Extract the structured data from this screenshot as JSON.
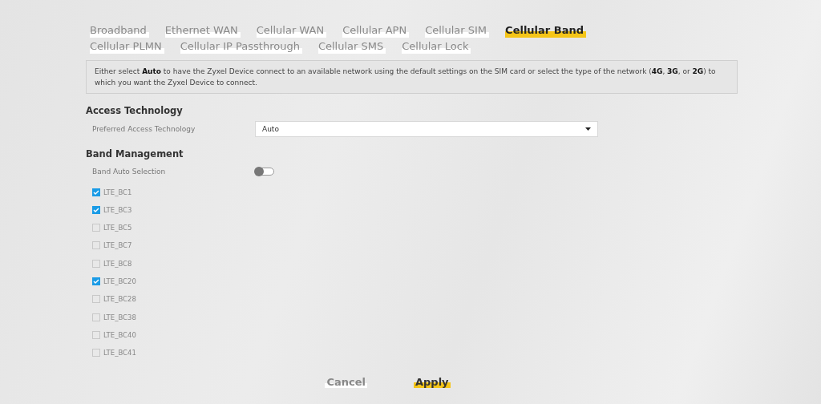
{
  "tabs": [
    {
      "label": "Broadband",
      "selected": false
    },
    {
      "label": "Ethernet WAN",
      "selected": false
    },
    {
      "label": "Cellular WAN",
      "selected": false
    },
    {
      "label": "Cellular APN",
      "selected": false
    },
    {
      "label": "Cellular SIM",
      "selected": false
    },
    {
      "label": "Cellular Band",
      "selected": true
    },
    {
      "label": "Cellular PLMN",
      "selected": false
    },
    {
      "label": "Cellular IP Passthrough",
      "selected": false
    },
    {
      "label": "Cellular SMS",
      "selected": false
    },
    {
      "label": "Cellular Lock",
      "selected": false
    }
  ],
  "info": "Either select **Auto** to have the Zyxel Device connect to an available network using the default settings on the SIM card or select the type of the network (**4G**, **3G**, or **2G**) to which you want the Zyxel Device to connect.",
  "access_technology": {
    "heading": "Access Technology",
    "label": "Preferred Access Technology",
    "value": "Auto"
  },
  "band_management": {
    "heading": "Band Management",
    "auto_selection": {
      "label": "Band Auto Selection",
      "on": false
    },
    "bands": [
      {
        "label": "LTE_BC1",
        "checked": true
      },
      {
        "label": "LTE_BC3",
        "checked": true
      },
      {
        "label": "LTE_BC5",
        "checked": false
      },
      {
        "label": "LTE_BC7",
        "checked": false
      },
      {
        "label": "LTE_BC8",
        "checked": false
      },
      {
        "label": "LTE_BC20",
        "checked": true
      },
      {
        "label": "LTE_BC28",
        "checked": false
      },
      {
        "label": "LTE_BC38",
        "checked": false
      },
      {
        "label": "LTE_BC40",
        "checked": false
      },
      {
        "label": "LTE_BC41",
        "checked": false
      }
    ]
  },
  "buttons": [
    {
      "label": "Cancel",
      "kind": "secondary"
    },
    {
      "label": "Apply",
      "kind": "primary"
    }
  ]
}
